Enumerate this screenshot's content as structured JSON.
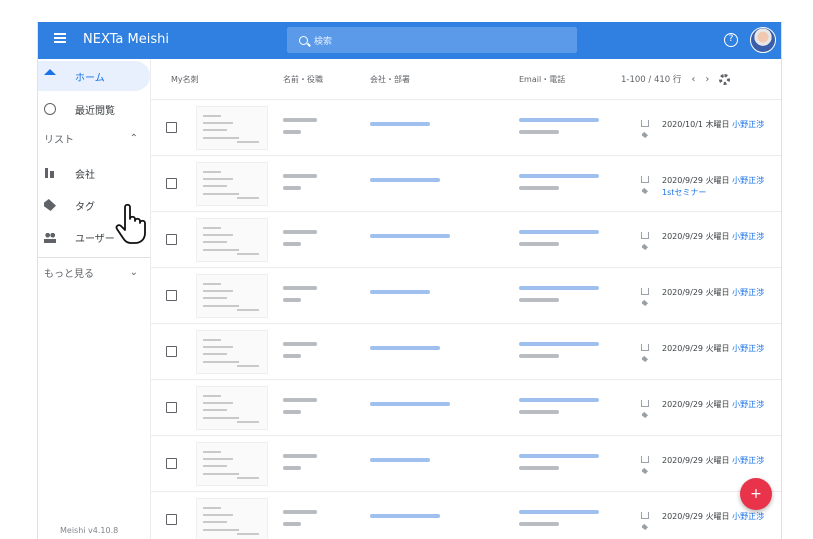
{
  "header": {
    "brand": "NEXTa Meishi",
    "search_placeholder": "検索"
  },
  "sidebar": {
    "items": [
      {
        "label": "ホーム",
        "icon": "home-icon"
      },
      {
        "label": "最近閲覧",
        "icon": "history-icon"
      },
      {
        "label": "会社",
        "icon": "building-icon"
      },
      {
        "label": "タグ",
        "icon": "tag-icon"
      },
      {
        "label": "ユーザー",
        "icon": "people-icon"
      }
    ],
    "list_section": "リスト",
    "more_section": "もっと見る",
    "version": "Meishi v4.10.8"
  },
  "table": {
    "columns": [
      "My名刺",
      "名前・役職",
      "会社・部署",
      "Email・電話"
    ],
    "pagination": "1-100 / 410 行",
    "rows": [
      {
        "date": "2020/10/1 木曜日",
        "owner": "小野正渉",
        "event": ""
      },
      {
        "date": "2020/9/29 火曜日",
        "owner": "小野正渉",
        "event": "1stセミナー"
      },
      {
        "date": "2020/9/29 火曜日",
        "owner": "小野正渉",
        "event": ""
      },
      {
        "date": "2020/9/29 火曜日",
        "owner": "小野正渉",
        "event": ""
      },
      {
        "date": "2020/9/29 火曜日",
        "owner": "小野正渉",
        "event": ""
      },
      {
        "date": "2020/9/29 火曜日",
        "owner": "小野正渉",
        "event": ""
      },
      {
        "date": "2020/9/29 火曜日",
        "owner": "小野正渉",
        "event": ""
      },
      {
        "date": "2020/9/29 火曜日",
        "owner": "小野正渉",
        "event": ""
      }
    ]
  },
  "fab_label": "+",
  "colors": {
    "header": "#2f80e0",
    "accent": "#1a73e8",
    "fab": "#e8334a"
  }
}
